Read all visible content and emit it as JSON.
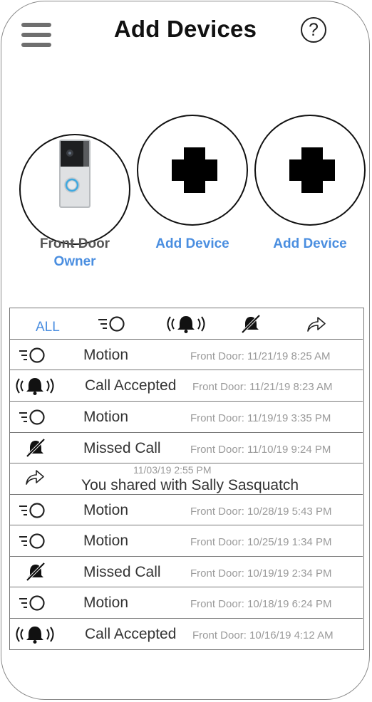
{
  "header": {
    "title": "Add Devices",
    "help_label": "?"
  },
  "devices": [
    {
      "name": "Front Door",
      "role": "Owner"
    },
    {
      "name": "Add Device"
    },
    {
      "name": "Add Device"
    }
  ],
  "tabs": {
    "all_label": "ALL",
    "icons": [
      "motion-icon",
      "ring-icon",
      "missed-call-icon",
      "share-icon"
    ]
  },
  "events": [
    {
      "type": "motion",
      "label": "Motion",
      "meta": "Front Door: 11/21/19 8:25 AM"
    },
    {
      "type": "ring",
      "label": "Call Accepted",
      "meta": "Front Door: 11/21/19 8:23 AM"
    },
    {
      "type": "motion",
      "label": "Motion",
      "meta": "Front Door: 11/19/19 3:35 PM"
    },
    {
      "type": "missed",
      "label": "Missed Call",
      "meta": "Front Door: 11/10/19 9:24 PM"
    },
    {
      "type": "share",
      "label": "You  shared with Sally Sasquatch",
      "meta": "11/03/19 2:55 PM"
    },
    {
      "type": "motion",
      "label": "Motion",
      "meta": "Front Door: 10/28/19 5:43 PM"
    },
    {
      "type": "motion",
      "label": "Motion",
      "meta": "Front Door: 10/25/19 1:34 PM"
    },
    {
      "type": "missed",
      "label": "Missed Call",
      "meta": "Front Door: 10/19/19 2:34 PM"
    },
    {
      "type": "motion",
      "label": "Motion",
      "meta": "Front Door: 10/18/19 6:24 PM"
    },
    {
      "type": "ring",
      "label": "Call Accepted",
      "meta": "Front Door: 10/16/19 4:12 AM"
    }
  ],
  "colors": {
    "accent": "#4a8ee0",
    "text": "#333333",
    "meta": "#9a9a9a"
  }
}
